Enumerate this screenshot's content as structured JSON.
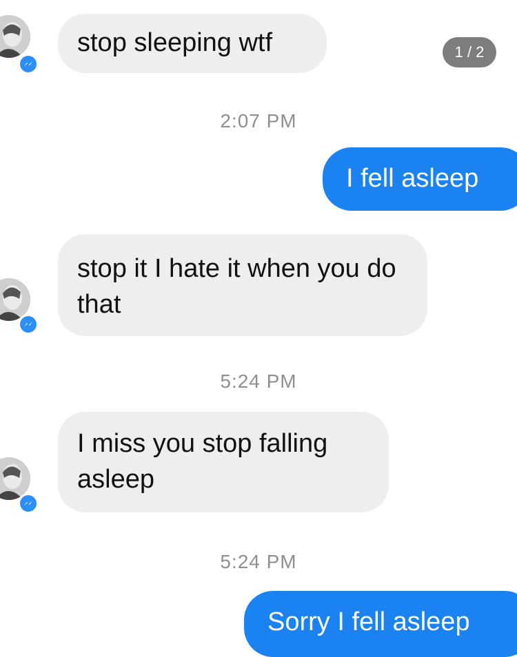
{
  "viewer": {
    "counter": "1 / 2"
  },
  "conversation": {
    "messages": [
      {
        "text": "stop sleeping wtf"
      },
      {
        "timestamp": "2:07 PM"
      },
      {
        "text": "I fell asleep"
      },
      {
        "text": "stop it I hate it when you do that"
      },
      {
        "timestamp": "5:24 PM"
      },
      {
        "text": "I miss you stop falling asleep"
      },
      {
        "timestamp": "5:24 PM"
      },
      {
        "text": "Sorry I fell asleep"
      }
    ]
  },
  "colors": {
    "incoming_bubble": "#eeeeef",
    "outgoing_bubble": "#1b82f2",
    "timestamp_text": "#8e8e93",
    "messenger_badge": "#2c8ef8"
  },
  "icons": {
    "messenger_badge": "messenger-icon",
    "avatar": "contact-avatar"
  }
}
